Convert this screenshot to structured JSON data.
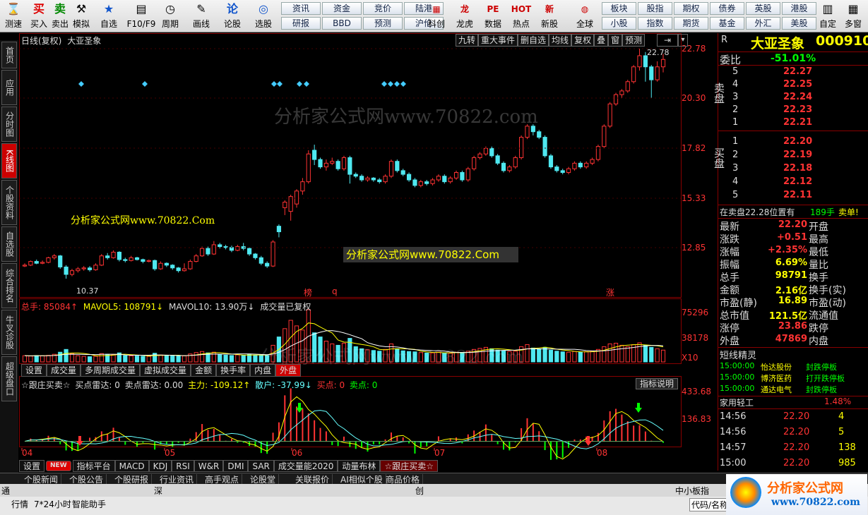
{
  "toolbar": {
    "buttons": [
      {
        "label": "测速",
        "icon": "⌛"
      },
      {
        "label": "买入",
        "icon": "买"
      },
      {
        "label": "卖出",
        "icon": "卖"
      },
      {
        "label": "模拟",
        "icon": "⚒"
      },
      {
        "label": "自选",
        "icon": "★"
      },
      {
        "label": "F10/F9",
        "icon": "▤"
      },
      {
        "label": "周期",
        "icon": "◷"
      },
      {
        "label": "画线",
        "icon": "✎"
      },
      {
        "label": "论股",
        "icon": "论"
      },
      {
        "label": "选股",
        "icon": "◎"
      }
    ],
    "quick": [
      [
        "资讯",
        "资金",
        "竞价",
        "陆港"
      ],
      [
        "研报",
        "BBD",
        "预测",
        "沪伦"
      ]
    ],
    "buttons2": [
      {
        "label": "科创",
        "icon": "▦"
      },
      {
        "label": "龙虎",
        "icon": "龙"
      },
      {
        "label": "数据",
        "icon": "PE"
      },
      {
        "label": "热点",
        "icon": "HOT"
      },
      {
        "label": "新股",
        "icon": "新"
      },
      {
        "label": "全球",
        "icon": "◍"
      }
    ],
    "quick2": [
      [
        "板块",
        "股指",
        "期权",
        "债券",
        "英股",
        "港股"
      ],
      [
        "小股",
        "指数",
        "期货",
        "基金",
        "外汇",
        "美股"
      ]
    ],
    "end": [
      {
        "label": "自定",
        "icon": "▥"
      },
      {
        "label": "多窗",
        "icon": "▦"
      }
    ]
  },
  "left_tabs": [
    "首页",
    "应用",
    "分时图",
    "K线图",
    "个股资料",
    "自选股",
    "综合排名",
    "牛叉诊股",
    "超级盘口"
  ],
  "chart_header": {
    "period": "日线(复权)",
    "name": "大亚圣象",
    "buttons": [
      "九转",
      "重大事件",
      "删自选",
      "均线",
      "复权",
      "叠",
      "窗",
      "预测"
    ]
  },
  "watermark": "分析家公式网www.70822.com",
  "watermark2": "分析家公式网www.70822.Com",
  "kline_marks": {
    "low_label": "10.37",
    "high_label": "22.78",
    "flags": [
      "榜",
      "q",
      "涨"
    ]
  },
  "price_axis": [
    "22.78",
    "20.30",
    "17.82",
    "15.33",
    "12.85"
  ],
  "vol_header": {
    "total": "总手: 85084↑",
    "mavol5": "MAVOL5: 108791↓",
    "mavol10": "MAVOL10: 13.90万↓",
    "note": "成交量已复权"
  },
  "vol_axis": [
    "75296",
    "38178",
    "X10"
  ],
  "vol_tabs": [
    "设置",
    "成交量",
    "多周期成交量",
    "虚拟成交量",
    "金额",
    "换手率",
    "内盘",
    "外盘"
  ],
  "ind_header": {
    "name": "☆跟庄买卖☆",
    "buy_radar": "买点雷达: 0",
    "sell_radar": "卖点雷达: 0.00",
    "main": "主力: -109.12↑",
    "retail": "散户: -37.99↓",
    "buy": "买点: 0",
    "sell": "卖点: 0",
    "help": "指标说明"
  },
  "ind_axis": [
    "433.68",
    "136.83"
  ],
  "months": [
    "04",
    "05",
    "06",
    "07",
    "08"
  ],
  "ind_tabs": [
    "设置",
    "NEW",
    "指标平台",
    "MACD",
    "KDJ",
    "RSI",
    "W&R",
    "DMI",
    "SAR",
    "成交量能2020",
    "动量布林",
    "☆跟庄买卖☆"
  ],
  "news_tabs": [
    "个股新闻",
    "个股公告",
    "个股研报",
    "行业资讯",
    "高手观点",
    "论股堂",
    "关联报价",
    "AI相似个股",
    "商品价格"
  ],
  "status": {
    "left": [
      "通",
      "行情",
      "7*24小时",
      "智能助手"
    ],
    "mid": [
      "深",
      "创",
      "中小板指"
    ],
    "right": "代码/名称"
  },
  "quote": {
    "R": "R",
    "title": "大亚圣象",
    "code": "000910",
    "weibi_label": "委比",
    "weibi": "-51.01%",
    "sell_side": "卖盘",
    "buy_side": "买盘",
    "sell": [
      [
        "5",
        "22.27"
      ],
      [
        "4",
        "22.25"
      ],
      [
        "3",
        "22.24"
      ],
      [
        "2",
        "22.23"
      ],
      [
        "1",
        "22.21"
      ]
    ],
    "buy": [
      [
        "1",
        "22.20"
      ],
      [
        "2",
        "22.19"
      ],
      [
        "3",
        "22.18"
      ],
      [
        "4",
        "22.12"
      ],
      [
        "5",
        "22.11"
      ]
    ],
    "notice": "在卖盘22.28位置有",
    "notice_vol": "189手",
    "notice_tag": "卖单!",
    "stats": [
      [
        "最新",
        "22.20",
        "开盘"
      ],
      [
        "涨跌",
        "+0.51",
        "最高"
      ],
      [
        "涨幅",
        "+2.35%",
        "最低"
      ],
      [
        "振幅",
        "6.69%",
        "量比"
      ],
      [
        "总手",
        "98791",
        "换手"
      ],
      [
        "金额",
        "2.16亿",
        "换手(实)"
      ],
      [
        "市盈(静)",
        "16.89",
        "市盈(动)"
      ],
      [
        "总市值",
        "121.5亿",
        "流通值"
      ],
      [
        "涨停",
        "23.86",
        "跌停"
      ],
      [
        "外盘",
        "47869",
        "内盘"
      ]
    ],
    "short_title": "短线精灵",
    "short": [
      [
        "15:00:00",
        "怡达股份",
        "封跌停板"
      ],
      [
        "15:00:00",
        "博济医药",
        "打开跌停板"
      ],
      [
        "15:00:00",
        "通达电气",
        "封跌停板"
      ]
    ],
    "sector": [
      "家用轻工",
      "1.48%"
    ],
    "ticks": [
      [
        "14:56",
        "22.20",
        "4"
      ],
      [
        "14:56",
        "22.20",
        "5"
      ],
      [
        "14:57",
        "22.20",
        "138"
      ],
      [
        "15:00",
        "22.20",
        "985"
      ]
    ]
  },
  "logo": {
    "text": "分析家公式网",
    "url": "www.70822.com"
  },
  "chart_data": {
    "type": "candlestick",
    "price_range": [
      10.37,
      22.78
    ],
    "candles": [
      [
        11.05,
        11.1,
        11.0,
        11.2
      ],
      [
        11.1,
        11.3,
        11.05,
        11.35
      ],
      [
        11.3,
        11.2,
        11.15,
        11.4
      ],
      [
        11.2,
        11.25,
        11.15,
        11.35
      ],
      [
        11.25,
        11.5,
        11.2,
        11.55
      ],
      [
        11.5,
        11.6,
        11.4,
        11.7
      ],
      [
        11.6,
        11.0,
        10.9,
        11.65
      ],
      [
        11.0,
        10.6,
        10.37,
        11.1
      ],
      [
        10.6,
        10.8,
        10.5,
        10.9
      ],
      [
        10.8,
        10.9,
        10.7,
        11.0
      ],
      [
        10.9,
        10.95,
        10.8,
        11.05
      ],
      [
        10.95,
        10.85,
        10.75,
        11.05
      ],
      [
        10.85,
        11.1,
        10.8,
        11.2
      ],
      [
        11.1,
        11.6,
        11.05,
        11.7
      ],
      [
        11.6,
        11.5,
        11.4,
        11.75
      ],
      [
        11.5,
        11.8,
        11.45,
        11.9
      ],
      [
        11.8,
        11.4,
        11.3,
        11.85
      ],
      [
        11.4,
        11.35,
        11.25,
        11.5
      ],
      [
        11.35,
        11.5,
        11.3,
        11.6
      ],
      [
        11.5,
        11.4,
        11.35,
        11.55
      ],
      [
        11.4,
        11.3,
        11.2,
        11.45
      ],
      [
        11.3,
        11.35,
        11.25,
        11.4
      ],
      [
        11.35,
        10.9,
        10.8,
        11.4
      ],
      [
        10.9,
        11.2,
        10.85,
        11.3
      ],
      [
        11.2,
        11.1,
        11.0,
        11.25
      ],
      [
        11.1,
        10.95,
        10.85,
        11.15
      ],
      [
        10.95,
        10.8,
        10.7,
        11.0
      ],
      [
        10.8,
        10.9,
        10.75,
        11.2
      ],
      [
        10.9,
        11.3,
        10.85,
        11.4
      ],
      [
        11.3,
        11.6,
        11.25,
        11.7
      ],
      [
        11.6,
        12.0,
        11.55,
        12.1
      ],
      [
        12.0,
        11.7,
        11.6,
        12.1
      ],
      [
        11.7,
        12.2,
        11.65,
        12.4
      ],
      [
        12.2,
        12.1,
        12.0,
        12.3
      ],
      [
        12.1,
        12.05,
        11.95,
        12.2
      ],
      [
        12.05,
        11.9,
        11.8,
        12.15
      ],
      [
        11.9,
        12.1,
        11.85,
        12.2
      ],
      [
        12.1,
        12.0,
        11.9,
        12.3
      ],
      [
        12.0,
        11.7,
        11.6,
        12.05
      ],
      [
        11.7,
        11.5,
        11.4,
        11.75
      ],
      [
        11.5,
        11.2,
        11.1,
        11.6
      ],
      [
        11.2,
        11.05,
        10.95,
        11.3
      ],
      [
        11.05,
        12.35,
        11.0,
        12.45
      ],
      [
        13.2,
        12.9,
        12.6,
        13.3
      ],
      [
        14.2,
        14.5,
        13.8,
        14.6
      ],
      [
        14.0,
        14.8,
        13.5,
        14.9
      ],
      [
        14.4,
        15.1,
        14.2,
        15.2
      ],
      [
        15.1,
        15.6,
        14.9,
        15.8
      ],
      [
        15.6,
        17.1,
        15.5,
        17.3
      ],
      [
        17.3,
        16.8,
        16.5,
        17.6
      ],
      [
        16.8,
        16.4,
        16.3,
        16.9
      ],
      [
        16.4,
        16.6,
        16.2,
        16.8
      ],
      [
        16.6,
        16.7,
        16.5,
        16.9
      ],
      [
        16.7,
        16.3,
        16.2,
        16.8
      ],
      [
        16.3,
        16.9,
        16.2,
        17.0
      ],
      [
        16.9,
        16.0,
        15.5,
        17.0
      ],
      [
        16.0,
        15.9,
        15.8,
        16.1
      ],
      [
        15.9,
        15.7,
        15.6,
        16.0
      ],
      [
        15.7,
        15.8,
        15.6,
        15.9
      ],
      [
        15.8,
        15.7,
        15.6,
        15.85
      ],
      [
        15.7,
        15.6,
        15.5,
        15.8
      ],
      [
        15.6,
        15.9,
        15.5,
        16.0
      ],
      [
        15.9,
        16.7,
        15.8,
        16.8
      ],
      [
        16.7,
        16.2,
        16.1,
        16.8
      ],
      [
        16.2,
        16.0,
        15.9,
        16.3
      ],
      [
        16.0,
        15.7,
        15.6,
        16.1
      ],
      [
        15.7,
        15.4,
        15.3,
        15.8
      ],
      [
        15.4,
        15.6,
        15.3,
        15.7
      ],
      [
        15.6,
        15.5,
        15.4,
        15.7
      ],
      [
        15.5,
        15.7,
        15.4,
        15.8
      ],
      [
        15.7,
        15.9,
        15.6,
        16.0
      ],
      [
        15.9,
        15.6,
        15.5,
        16.0
      ],
      [
        15.6,
        15.8,
        15.5,
        15.9
      ],
      [
        15.8,
        16.1,
        15.7,
        16.2
      ],
      [
        16.1,
        15.7,
        15.6,
        16.2
      ],
      [
        15.7,
        16.3,
        15.6,
        16.4
      ],
      [
        16.3,
        16.9,
        16.2,
        17.0
      ],
      [
        16.9,
        17.1,
        16.8,
        17.2
      ],
      [
        17.1,
        17.4,
        17.0,
        17.5
      ],
      [
        17.4,
        17.0,
        16.9,
        17.5
      ],
      [
        17.0,
        16.6,
        16.5,
        17.1
      ],
      [
        16.6,
        16.2,
        16.1,
        16.7
      ],
      [
        16.2,
        16.4,
        16.1,
        16.5
      ],
      [
        16.4,
        16.9,
        16.3,
        17.0
      ],
      [
        16.9,
        18.0,
        16.8,
        18.1
      ],
      [
        18.0,
        18.6,
        17.9,
        18.7
      ],
      [
        18.6,
        18.3,
        18.1,
        18.7
      ],
      [
        18.3,
        18.0,
        17.9,
        18.4
      ],
      [
        18.0,
        17.0,
        16.9,
        18.1
      ],
      [
        17.0,
        16.4,
        16.3,
        17.1
      ],
      [
        16.4,
        16.2,
        16.1,
        16.5
      ],
      [
        16.2,
        16.1,
        16.0,
        16.3
      ],
      [
        16.1,
        16.3,
        16.0,
        16.4
      ],
      [
        16.3,
        16.6,
        16.2,
        16.7
      ],
      [
        16.6,
        16.4,
        16.3,
        16.7
      ],
      [
        16.4,
        16.6,
        16.3,
        16.7
      ],
      [
        16.6,
        16.8,
        16.5,
        16.9
      ],
      [
        16.8,
        17.5,
        16.7,
        17.6
      ],
      [
        17.5,
        18.6,
        17.4,
        18.7
      ],
      [
        18.6,
        19.8,
        18.5,
        19.9
      ],
      [
        19.8,
        20.3,
        19.7,
        20.4
      ],
      [
        20.3,
        20.5,
        20.1,
        20.6
      ],
      [
        20.5,
        21.0,
        20.4,
        21.1
      ],
      [
        21.0,
        21.8,
        20.9,
        21.9
      ],
      [
        21.8,
        22.4,
        21.6,
        22.78
      ],
      [
        22.4,
        21.8,
        21.0,
        22.6
      ],
      [
        21.8,
        21.1,
        20.1,
        21.9
      ],
      [
        21.1,
        21.8,
        21.0,
        22.1
      ],
      [
        21.8,
        22.2,
        21.5,
        22.5
      ]
    ],
    "volume_range": [
      0,
      75296
    ],
    "volumes": [
      9000,
      8500,
      9200,
      8800,
      9500,
      11000,
      14000,
      18000,
      12000,
      9000,
      8000,
      7500,
      8200,
      12000,
      11000,
      10500,
      13000,
      9000,
      8800,
      8500,
      8200,
      8000,
      12500,
      10000,
      9200,
      8600,
      8200,
      8800,
      11500,
      13500,
      15000,
      13000,
      14000,
      10500,
      9800,
      9200,
      10200,
      9500,
      11000,
      9800,
      10500,
      9200,
      24000,
      36000,
      48000,
      60000,
      52000,
      46000,
      75296,
      42000,
      36000,
      30000,
      26000,
      24000,
      27000,
      34000,
      22000,
      19000,
      17500,
      16500,
      15500,
      18000,
      26000,
      19000,
      16000,
      15000,
      14500,
      13500,
      12800,
      13000,
      14000,
      13000,
      12500,
      14000,
      13500,
      15500,
      18000,
      19500,
      21000,
      19000,
      17000,
      16000,
      15000,
      15500,
      22000,
      25000,
      20000,
      18000,
      21000,
      17000,
      15500,
      14500,
      14000,
      15000,
      14200,
      14800,
      15200,
      18000,
      22000,
      26000,
      27000,
      24000,
      22000,
      25000,
      27500,
      24000,
      21000,
      19000,
      17000
    ],
    "indicator_range": [
      -40,
      433.68
    ]
  }
}
